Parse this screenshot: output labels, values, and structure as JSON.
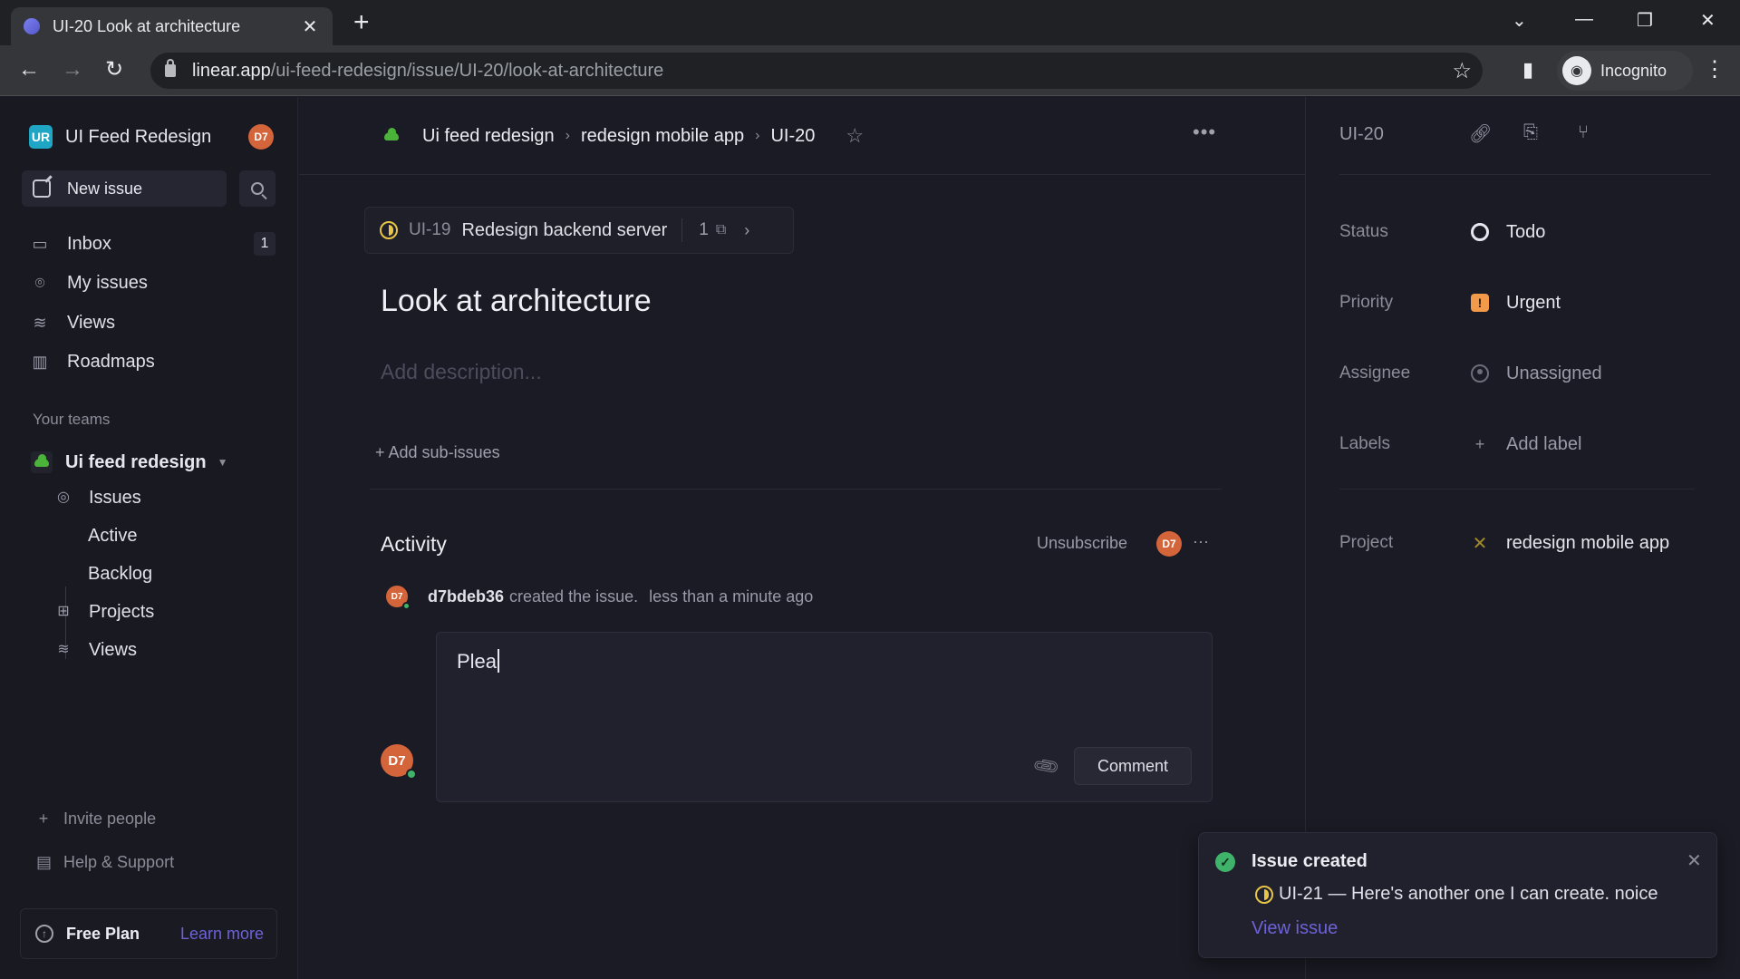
{
  "browser": {
    "tab_title": "UI-20 Look at architecture",
    "url_host": "linear.app",
    "url_path": "/ui-feed-redesign/issue/UI-20/look-at-architecture",
    "profile_label": "Incognito"
  },
  "sidebar": {
    "workspace_initials": "UR",
    "workspace_name": "UI Feed Redesign",
    "user_initials": "D7",
    "new_issue_label": "New issue",
    "nav": [
      {
        "label": "Inbox",
        "badge": "1",
        "icon": "inbox-icon"
      },
      {
        "label": "My issues",
        "icon": "target-icon"
      },
      {
        "label": "Views",
        "icon": "layers-icon"
      },
      {
        "label": "Roadmaps",
        "icon": "map-icon"
      }
    ],
    "teams_label": "Your teams",
    "team": {
      "name": "Ui feed redesign",
      "items": [
        {
          "label": "Issues",
          "icon": "issues-icon"
        },
        {
          "label": "Active"
        },
        {
          "label": "Backlog"
        },
        {
          "label": "Projects",
          "icon": "grid-icon"
        },
        {
          "label": "Views",
          "icon": "layers-icon"
        }
      ]
    },
    "invite_label": "Invite people",
    "help_label": "Help & Support",
    "plan_label": "Free Plan",
    "plan_link": "Learn more"
  },
  "main": {
    "breadcrumb": [
      "Ui feed redesign",
      "redesign mobile app",
      "UI-20"
    ],
    "parent_issue": {
      "id": "UI-19",
      "title": "Redesign backend server",
      "sub_count": "1"
    },
    "title": "Look at architecture",
    "description_placeholder": "Add description...",
    "add_sub_issues": "+ Add sub-issues",
    "activity": {
      "heading": "Activity",
      "unsubscribe": "Unsubscribe",
      "subscriber_initials": "D7",
      "events": [
        {
          "user": "d7bdeb36",
          "action": "created the issue.",
          "time": "less than a minute ago",
          "initials": "D7"
        }
      ]
    },
    "comment": {
      "value": "Plea",
      "button": "Comment",
      "author_initials": "D7"
    }
  },
  "details": {
    "issue_id": "UI-20",
    "properties": [
      {
        "key": "Status",
        "value": "Todo"
      },
      {
        "key": "Priority",
        "value": "Urgent"
      },
      {
        "key": "Assignee",
        "value": "Unassigned"
      },
      {
        "key": "Labels",
        "value": "Add label"
      },
      {
        "key": "Project",
        "value": "redesign mobile app"
      }
    ]
  },
  "toast": {
    "title": "Issue created",
    "message": "UI-21 — Here's another one I can create. noice",
    "link": "View issue"
  },
  "colors": {
    "accent": "#6d62d6",
    "avatar": "#d4643a",
    "urgent": "#f2994a",
    "in_progress": "#e8c547",
    "success": "#3fb36a",
    "team_green": "#4cb33a",
    "workspace_teal": "#1fa6c4"
  }
}
